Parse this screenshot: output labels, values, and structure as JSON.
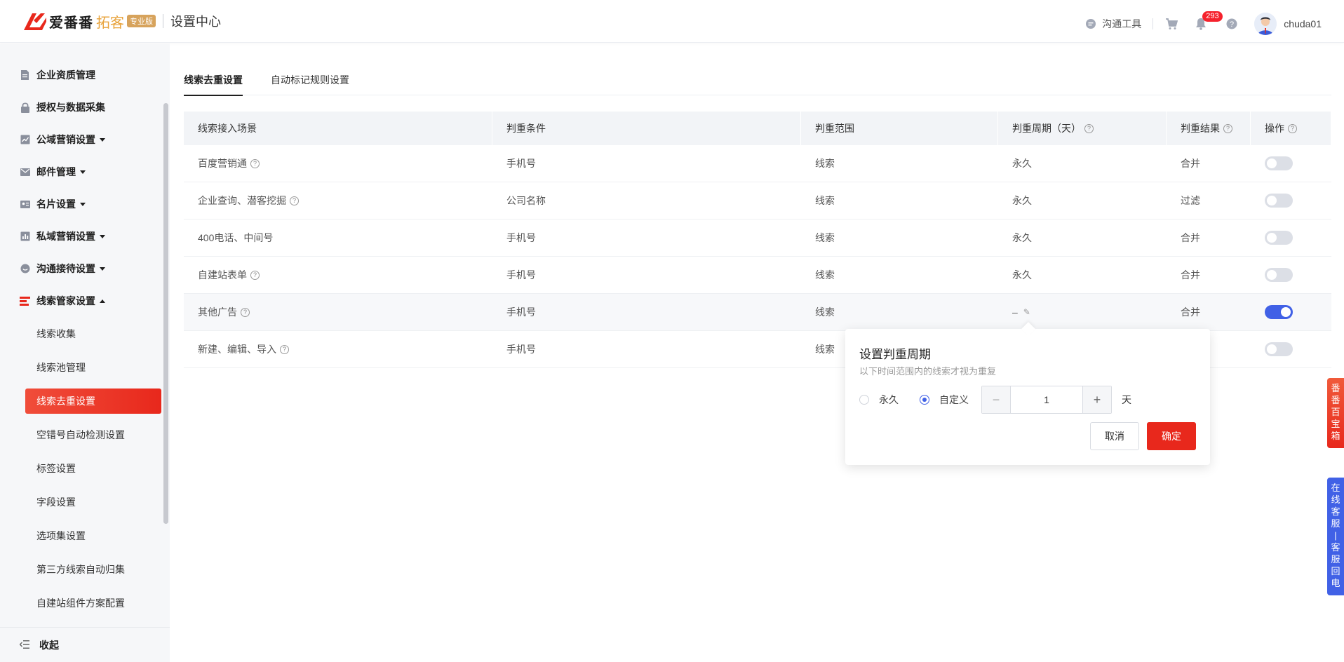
{
  "header": {
    "brand": "爱番番",
    "brand_sub": "拓客",
    "badge": "专业版",
    "title": "设置中心",
    "comm_tool": "沟通工具",
    "notification_count": "293",
    "username": "chuda01"
  },
  "sidebar": {
    "items": [
      {
        "label": "企业资质管理",
        "icon": "document-icon"
      },
      {
        "label": "授权与数据采集",
        "icon": "lock-icon"
      },
      {
        "label": "公域营销设置",
        "icon": "chart-icon"
      },
      {
        "label": "邮件管理",
        "icon": "mail-icon"
      },
      {
        "label": "名片设置",
        "icon": "card-icon"
      },
      {
        "label": "私域营销设置",
        "icon": "bar-chart-icon"
      },
      {
        "label": "沟通接待设置",
        "icon": "chat-icon"
      },
      {
        "label": "线索管家设置",
        "icon": "clue-icon"
      }
    ],
    "sub_items": [
      "线索收集",
      "线索池管理",
      "线索去重设置",
      "空错号自动检测设置",
      "标签设置",
      "字段设置",
      "选项集设置",
      "第三方线索自动归集",
      "自建站组件方案配置"
    ],
    "active_sub": "线索去重设置",
    "collapse": "收起"
  },
  "tabs": [
    "线索去重设置",
    "自动标记规则设置"
  ],
  "table": {
    "headers": [
      "线索接入场景",
      "判重条件",
      "判重范围",
      "判重周期（天）",
      "判重结果",
      "操作"
    ],
    "rows": [
      {
        "scene": "百度营销通",
        "cond": "手机号",
        "range": "线索",
        "period": "永久",
        "result": "合并",
        "on": false
      },
      {
        "scene": "企业查询、潜客挖掘",
        "cond": "公司名称",
        "range": "线索",
        "period": "永久",
        "result": "过滤",
        "on": false
      },
      {
        "scene": "400电话、中间号",
        "cond": "手机号",
        "range": "线索",
        "period": "永久",
        "result": "合并",
        "on": false
      },
      {
        "scene": "自建站表单",
        "cond": "手机号",
        "range": "线索",
        "period": "永久",
        "result": "合并",
        "on": false
      },
      {
        "scene": "其他广告",
        "cond": "手机号",
        "range": "线索",
        "period": "–",
        "result": "合并",
        "on": true
      },
      {
        "scene": "新建、编辑、导入",
        "cond": "手机号",
        "range": "线索",
        "period": "",
        "result": "",
        "on": false
      }
    ]
  },
  "popover": {
    "title": "设置判重周期",
    "desc": "以下时间范围内的线索才视为重复",
    "opt_forever": "永久",
    "opt_custom": "自定义",
    "value": "1",
    "unit": "天",
    "cancel": "取消",
    "ok": "确定"
  },
  "float": {
    "red": "番番百宝箱",
    "blue": "在线客服—客服回电"
  }
}
